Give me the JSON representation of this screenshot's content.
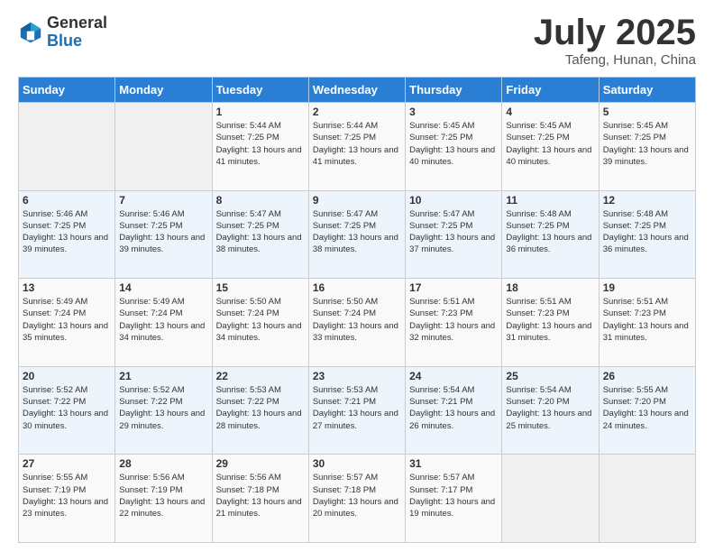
{
  "header": {
    "logo_general": "General",
    "logo_blue": "Blue",
    "month_title": "July 2025",
    "location": "Tafeng, Hunan, China"
  },
  "days_of_week": [
    "Sunday",
    "Monday",
    "Tuesday",
    "Wednesday",
    "Thursday",
    "Friday",
    "Saturday"
  ],
  "weeks": [
    [
      {
        "day": "",
        "info": ""
      },
      {
        "day": "",
        "info": ""
      },
      {
        "day": "1",
        "sunrise": "5:44 AM",
        "sunset": "7:25 PM",
        "daylight": "13 hours and 41 minutes."
      },
      {
        "day": "2",
        "sunrise": "5:44 AM",
        "sunset": "7:25 PM",
        "daylight": "13 hours and 41 minutes."
      },
      {
        "day": "3",
        "sunrise": "5:45 AM",
        "sunset": "7:25 PM",
        "daylight": "13 hours and 40 minutes."
      },
      {
        "day": "4",
        "sunrise": "5:45 AM",
        "sunset": "7:25 PM",
        "daylight": "13 hours and 40 minutes."
      },
      {
        "day": "5",
        "sunrise": "5:45 AM",
        "sunset": "7:25 PM",
        "daylight": "13 hours and 39 minutes."
      }
    ],
    [
      {
        "day": "6",
        "sunrise": "5:46 AM",
        "sunset": "7:25 PM",
        "daylight": "13 hours and 39 minutes."
      },
      {
        "day": "7",
        "sunrise": "5:46 AM",
        "sunset": "7:25 PM",
        "daylight": "13 hours and 39 minutes."
      },
      {
        "day": "8",
        "sunrise": "5:47 AM",
        "sunset": "7:25 PM",
        "daylight": "13 hours and 38 minutes."
      },
      {
        "day": "9",
        "sunrise": "5:47 AM",
        "sunset": "7:25 PM",
        "daylight": "13 hours and 38 minutes."
      },
      {
        "day": "10",
        "sunrise": "5:47 AM",
        "sunset": "7:25 PM",
        "daylight": "13 hours and 37 minutes."
      },
      {
        "day": "11",
        "sunrise": "5:48 AM",
        "sunset": "7:25 PM",
        "daylight": "13 hours and 36 minutes."
      },
      {
        "day": "12",
        "sunrise": "5:48 AM",
        "sunset": "7:25 PM",
        "daylight": "13 hours and 36 minutes."
      }
    ],
    [
      {
        "day": "13",
        "sunrise": "5:49 AM",
        "sunset": "7:24 PM",
        "daylight": "13 hours and 35 minutes."
      },
      {
        "day": "14",
        "sunrise": "5:49 AM",
        "sunset": "7:24 PM",
        "daylight": "13 hours and 34 minutes."
      },
      {
        "day": "15",
        "sunrise": "5:50 AM",
        "sunset": "7:24 PM",
        "daylight": "13 hours and 34 minutes."
      },
      {
        "day": "16",
        "sunrise": "5:50 AM",
        "sunset": "7:24 PM",
        "daylight": "13 hours and 33 minutes."
      },
      {
        "day": "17",
        "sunrise": "5:51 AM",
        "sunset": "7:23 PM",
        "daylight": "13 hours and 32 minutes."
      },
      {
        "day": "18",
        "sunrise": "5:51 AM",
        "sunset": "7:23 PM",
        "daylight": "13 hours and 31 minutes."
      },
      {
        "day": "19",
        "sunrise": "5:51 AM",
        "sunset": "7:23 PM",
        "daylight": "13 hours and 31 minutes."
      }
    ],
    [
      {
        "day": "20",
        "sunrise": "5:52 AM",
        "sunset": "7:22 PM",
        "daylight": "13 hours and 30 minutes."
      },
      {
        "day": "21",
        "sunrise": "5:52 AM",
        "sunset": "7:22 PM",
        "daylight": "13 hours and 29 minutes."
      },
      {
        "day": "22",
        "sunrise": "5:53 AM",
        "sunset": "7:22 PM",
        "daylight": "13 hours and 28 minutes."
      },
      {
        "day": "23",
        "sunrise": "5:53 AM",
        "sunset": "7:21 PM",
        "daylight": "13 hours and 27 minutes."
      },
      {
        "day": "24",
        "sunrise": "5:54 AM",
        "sunset": "7:21 PM",
        "daylight": "13 hours and 26 minutes."
      },
      {
        "day": "25",
        "sunrise": "5:54 AM",
        "sunset": "7:20 PM",
        "daylight": "13 hours and 25 minutes."
      },
      {
        "day": "26",
        "sunrise": "5:55 AM",
        "sunset": "7:20 PM",
        "daylight": "13 hours and 24 minutes."
      }
    ],
    [
      {
        "day": "27",
        "sunrise": "5:55 AM",
        "sunset": "7:19 PM",
        "daylight": "13 hours and 23 minutes."
      },
      {
        "day": "28",
        "sunrise": "5:56 AM",
        "sunset": "7:19 PM",
        "daylight": "13 hours and 22 minutes."
      },
      {
        "day": "29",
        "sunrise": "5:56 AM",
        "sunset": "7:18 PM",
        "daylight": "13 hours and 21 minutes."
      },
      {
        "day": "30",
        "sunrise": "5:57 AM",
        "sunset": "7:18 PM",
        "daylight": "13 hours and 20 minutes."
      },
      {
        "day": "31",
        "sunrise": "5:57 AM",
        "sunset": "7:17 PM",
        "daylight": "13 hours and 19 minutes."
      },
      {
        "day": "",
        "info": ""
      },
      {
        "day": "",
        "info": ""
      }
    ]
  ],
  "labels": {
    "sunrise_prefix": "Sunrise: ",
    "sunset_prefix": "Sunset: ",
    "daylight_prefix": "Daylight: "
  }
}
